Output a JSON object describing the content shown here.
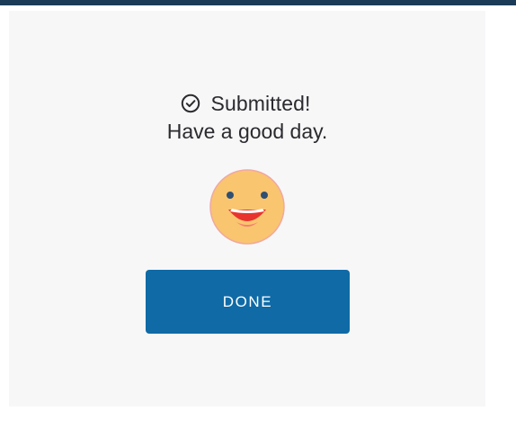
{
  "confirmation": {
    "title": "Submitted!",
    "message": "Have a good day.",
    "icon": "check-circle-icon",
    "emoji": "smiling-face-icon"
  },
  "actions": {
    "done_label": "DONE"
  },
  "colors": {
    "accent": "#0f6aa6",
    "top_bar": "#1b3a57",
    "card_background": "#f7f7f8",
    "text": "#2b2b2f",
    "emoji_face": "#f9c56f",
    "emoji_mouth": "#e8342e"
  }
}
